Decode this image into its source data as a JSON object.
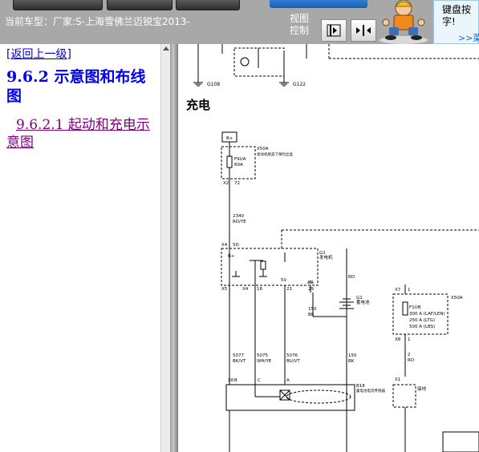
{
  "header": {
    "current_car_label": "当前车型：厂家:S-上海雪佛兰迈锐宝2013-",
    "view_control_label": "视图控制",
    "tip_text": "键盘按字!",
    "tip_link": ">>菜"
  },
  "left_panel": {
    "back_link": "[返回上一级]",
    "section_title": "9.6.2 示意图和布线图",
    "sub_link": "9.6.2.1 起动和充电示意图"
  },
  "diagram": {
    "section_heading": "充电",
    "ground_labels": [
      "G108",
      "G122"
    ],
    "fuse_box": {
      "battery": "B+",
      "id": "X50A",
      "name": "发动机舱盖下保险丝盒",
      "fuse": "F9UA",
      "rating": "60A",
      "pins": [
        "X2",
        "72"
      ]
    },
    "wire_labels": [
      "2340",
      "RD/YE",
      "5077",
      "BK/VT",
      "5075",
      "WH/YE",
      "5076",
      "BU/VT",
      "150",
      "BK",
      "150",
      "BK"
    ],
    "generator": {
      "id": "G1",
      "name": "发电机",
      "terminals": [
        "B+",
        "X4",
        "5D",
        "X5",
        "X4",
        "16",
        "5V",
        "21",
        "29"
      ]
    },
    "connector_labels": [
      "X6",
      "B",
      "C",
      "A",
      "B18",
      "蓄电池电流传感器"
    ],
    "battery": {
      "id": "G1",
      "name": "蓄电池",
      "wire": "RD"
    },
    "fuse_right": {
      "id": "X50A",
      "rating_lines": [
        "F1UB",
        "300 A (LAF/LEN)",
        "250 A (LTG)",
        "500 A (LBS)"
      ],
      "pins": [
        "X7",
        "1",
        "X8",
        "1"
      ]
    },
    "ground_right": {
      "id": "X1",
      "name": "接地",
      "wire": "RD",
      "pin": "2"
    }
  }
}
